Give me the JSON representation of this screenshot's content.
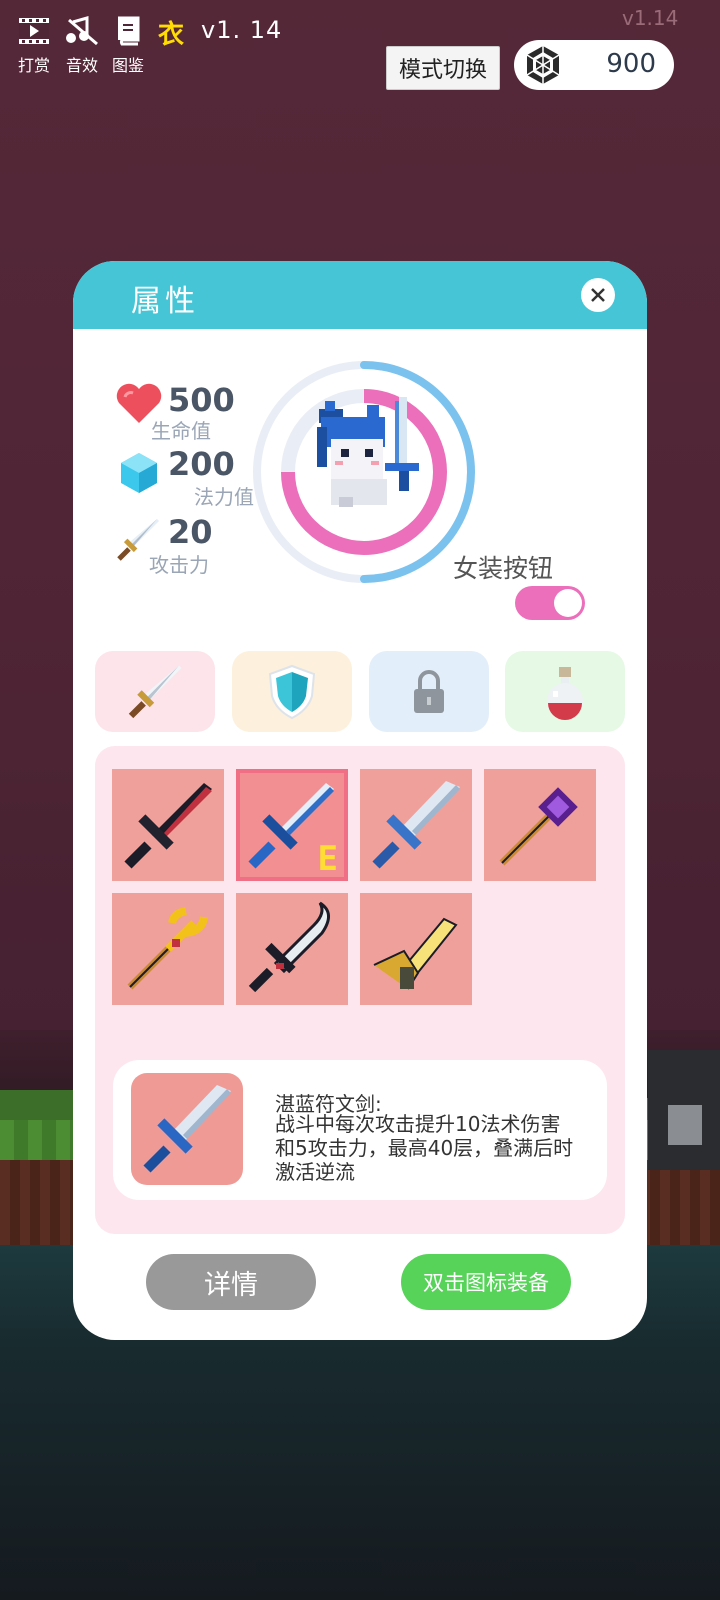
{
  "hud": {
    "buttons": [
      {
        "label": "打赏",
        "icon": "film-icon"
      },
      {
        "label": "音效",
        "icon": "music-off-icon"
      },
      {
        "label": "图鉴",
        "icon": "book-icon"
      }
    ],
    "letter": "衣",
    "version": "v1. 14",
    "corner_version": "v1.14",
    "mode_switch": "模式切换",
    "gems": "900"
  },
  "panel": {
    "title": "属性",
    "stats": {
      "hp": {
        "value": "500",
        "label": "生命值",
        "icon": "heart-icon",
        "color": "#ee4f5c"
      },
      "mp": {
        "value": "200",
        "label": "法力值",
        "icon": "crystal-icon",
        "color": "#3cc7ec"
      },
      "atk": {
        "value": "20",
        "label": "攻击力",
        "icon": "sword-icon"
      }
    },
    "ring": {
      "hp_fraction": 0.75,
      "mp_fraction": 0.5
    },
    "female_toggle": {
      "label": "女装按钮",
      "on": true
    },
    "category_tabs": [
      {
        "icon": "sword-icon",
        "bg": "#fde3ea"
      },
      {
        "icon": "shield-icon",
        "bg": "#fdf0dc"
      },
      {
        "icon": "lock-icon",
        "bg": "#e3eefb"
      },
      {
        "icon": "potion-icon",
        "bg": "#e5f9e5"
      }
    ],
    "inventory": [
      {
        "item": "dark-sword",
        "equipped": false
      },
      {
        "item": "azure-rune-sword",
        "equipped": true,
        "mark": "E"
      },
      {
        "item": "ice-sword",
        "equipped": false
      },
      {
        "item": "purple-staff",
        "equipped": false
      },
      {
        "item": "golden-trident-staff",
        "equipped": false
      },
      {
        "item": "silver-scimitar",
        "equipped": false
      },
      {
        "item": "golden-blade",
        "equipped": false
      }
    ],
    "selected": {
      "name": "湛蓝符文剑:",
      "description": "战斗中每次攻击提升10法术伤害和5攻击力，最高40层，叠满后时激活逆流"
    },
    "detail_button": "详情",
    "equip_button": "双击图标装备"
  }
}
